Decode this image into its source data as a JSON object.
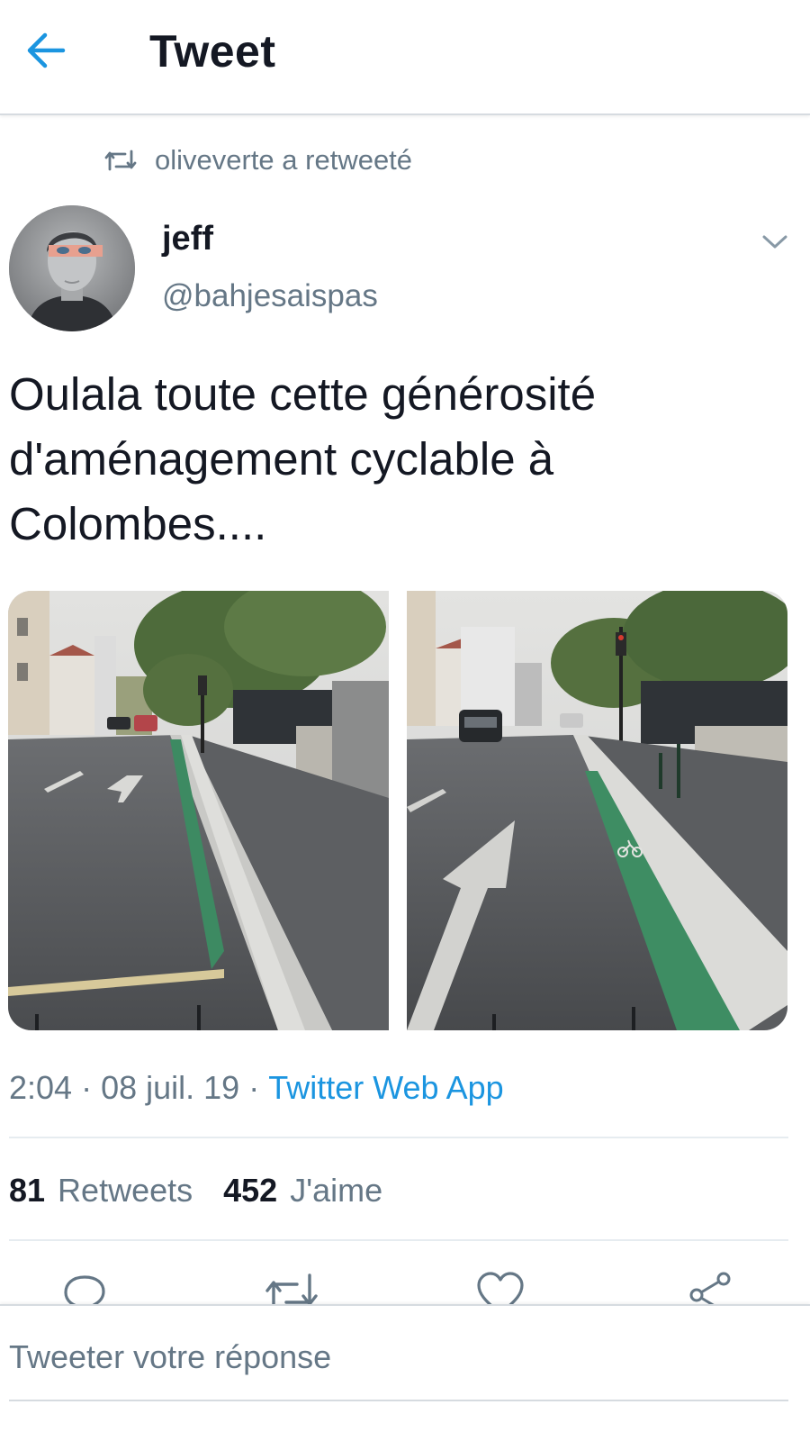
{
  "header": {
    "title": "Tweet"
  },
  "retweet_context": {
    "text": "oliveverte a retweeté"
  },
  "author": {
    "name": "jeff",
    "handle": "@bahjesaispas"
  },
  "tweet": {
    "text": "Oulala toute cette générosité d'aménagement cyclable à Colombes....",
    "time": "2:04",
    "date": "08 juil. 19",
    "source": "Twitter Web App",
    "separator": "·"
  },
  "stats": {
    "retweets_count": "81",
    "retweets_label": "Retweets",
    "likes_count": "452",
    "likes_label": "J'aime"
  },
  "reply": {
    "placeholder": "Tweeter votre réponse"
  },
  "colors": {
    "link": "#1b95e0",
    "secondary_text": "#657786",
    "primary_text": "#141823",
    "bike_lane": "#3d8a62"
  }
}
